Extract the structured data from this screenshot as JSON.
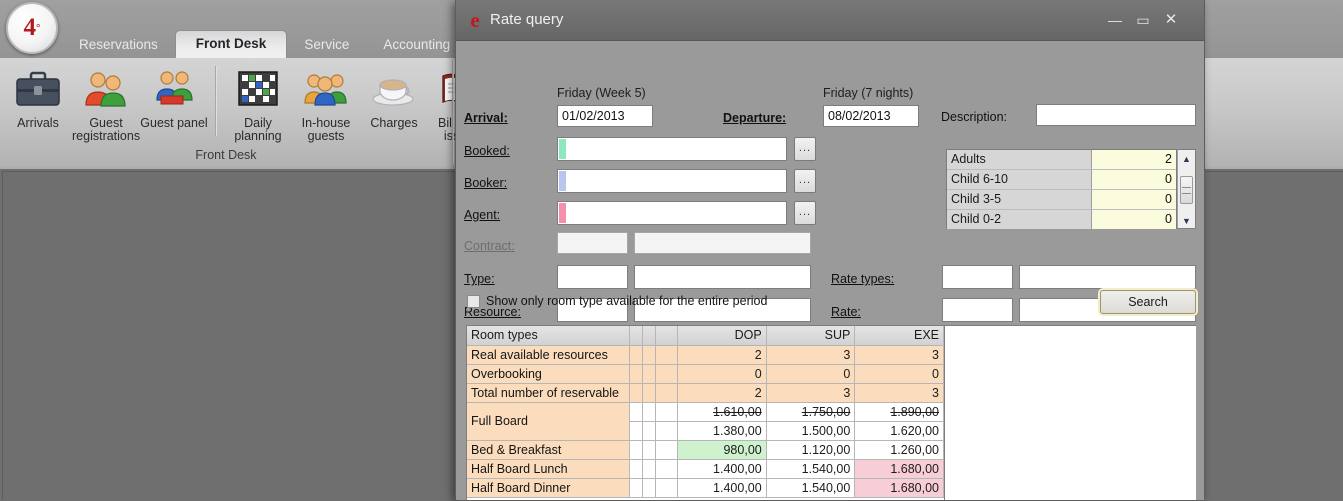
{
  "app": {
    "logo_text": "4",
    "logo_sup": "°",
    "tabs": [
      {
        "label": "Reservations",
        "active": false
      },
      {
        "label": "Front Desk",
        "active": true
      },
      {
        "label": "Service",
        "active": false
      },
      {
        "label": "Accounting",
        "active": false
      }
    ],
    "ribbon_group_label": "Front Desk",
    "ribbon_items": [
      {
        "label": "Arrivals",
        "icon": "briefcase-icon"
      },
      {
        "label": "Guest registrations",
        "icon": "two-people-icon"
      },
      {
        "label": "Guest panel",
        "icon": "people-panel-icon"
      },
      {
        "label": "Daily planning",
        "icon": "calendar-grid-icon"
      },
      {
        "label": "In-house guests",
        "icon": "group-people-icon"
      },
      {
        "label": "Charges",
        "icon": "coffee-cup-icon"
      },
      {
        "label": "Bill to be issued",
        "icon": "open-book-icon"
      }
    ]
  },
  "dialog": {
    "title": "Rate query",
    "icon": "e-logo-icon",
    "window_buttons": {
      "minimize": "—",
      "maximize": "▭",
      "close": "✕"
    },
    "arrival": {
      "label": "Arrival:",
      "hint": "Friday (Week 5)",
      "value": "01/02/2013"
    },
    "departure": {
      "label": "Departure:",
      "hint": "Friday (7 nights)",
      "value": "08/02/2013"
    },
    "description": {
      "label": "Description:",
      "value": "",
      "placeholder": ""
    },
    "booked": {
      "label": "Booked:",
      "value": "",
      "swatch": "#8ee8bf",
      "browse": "..."
    },
    "booker": {
      "label": "Booker:",
      "value": "",
      "swatch": "#b9c4ef",
      "browse": "..."
    },
    "agent": {
      "label": "Agent:",
      "value": "",
      "swatch": "#f48fad",
      "browse": "..."
    },
    "contract": {
      "label": "Contract:",
      "code": "",
      "value": "",
      "disabled": true
    },
    "type": {
      "label": "Type:",
      "code": "",
      "value": ""
    },
    "resource": {
      "label": "Resource:",
      "code": "",
      "value": ""
    },
    "rate_types": {
      "label": "Rate types:",
      "code": "",
      "value": ""
    },
    "rate": {
      "label": "Rate:",
      "code": "",
      "value": ""
    },
    "show_only_available": {
      "label": "Show only room type available for the entire period",
      "checked": false
    },
    "search_button": "Search",
    "occupancy": {
      "rows": [
        {
          "name": "Adults",
          "value": "2"
        },
        {
          "name": "Child 6-10",
          "value": "0"
        },
        {
          "name": "Child 3-5",
          "value": "0"
        },
        {
          "name": "Child 0-2",
          "value": "0"
        }
      ],
      "scroll_up": "▲",
      "scroll_down": "▼"
    }
  },
  "results": {
    "headers": [
      "Room types",
      "",
      "",
      "",
      "DOP",
      "SUP",
      "EXE"
    ],
    "rows": [
      {
        "name": "Real available resources",
        "style": "peach",
        "values": [
          "2",
          "3",
          "3"
        ]
      },
      {
        "name": "Overbooking",
        "style": "peach",
        "values": [
          "0",
          "0",
          "0"
        ]
      },
      {
        "name": "Total number of reservable",
        "style": "peach",
        "values": [
          "2",
          "3",
          "3"
        ]
      },
      {
        "name": "Full Board",
        "style": "strike",
        "values": [
          "1.610,00",
          "1.750,00",
          "1.890,00"
        ]
      },
      {
        "name": "",
        "style": "bold",
        "values": [
          "1.380,00",
          "1.500,00",
          "1.620,00"
        ]
      },
      {
        "name": "Bed & Breakfast",
        "style": "plain",
        "values": [
          "980,00",
          "1.120,00",
          "1.260,00"
        ],
        "cell_colors": [
          "green",
          "",
          ""
        ]
      },
      {
        "name": "Half Board Lunch",
        "style": "plain",
        "values": [
          "1.400,00",
          "1.540,00",
          "1.680,00"
        ],
        "cell_colors": [
          "",
          "",
          "pink"
        ]
      },
      {
        "name": "Half Board Dinner",
        "style": "plain",
        "values": [
          "1.400,00",
          "1.540,00",
          "1.680,00"
        ],
        "cell_colors": [
          "",
          "",
          "pink"
        ]
      }
    ]
  },
  "colors": {
    "accent_red": "#c4161c",
    "peach": "#fbddbe",
    "green_highlight": "#cdf2cd",
    "pink_highlight": "#f8ced6",
    "dialog_bg": "#9a9a9a",
    "workspace_bg": "#6f6f6f"
  }
}
